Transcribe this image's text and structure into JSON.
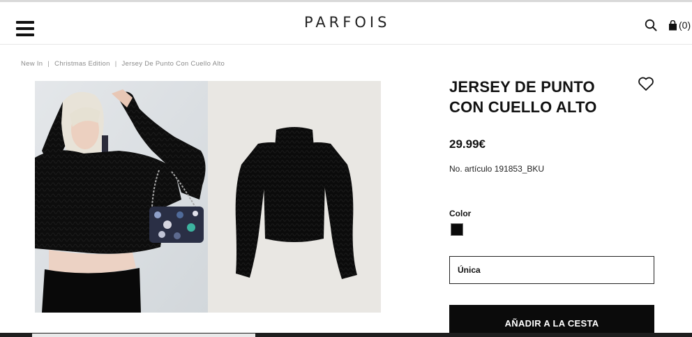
{
  "header": {
    "logo": "PARFOIS",
    "cart_count": "(0)"
  },
  "breadcrumb": [
    {
      "label": "New In"
    },
    {
      "label": "Christmas Edition"
    },
    {
      "label": "Jersey De Punto Con Cuello Alto"
    }
  ],
  "breadcrumb_separator": "|",
  "product": {
    "title": "JERSEY DE PUNTO CON CUELLO ALTO",
    "price": "29.99€",
    "sku": "No. artículo 191853_BKU",
    "color_label": "Color",
    "selected_color": "#0a0a0a",
    "size": "Única",
    "add_to_cart": "AÑADIR A LA CESTA"
  },
  "icons": {
    "menu": "hamburger-menu-icon",
    "search": "search-icon",
    "cart": "shopping-bag-icon",
    "wishlist": "heart-icon"
  },
  "colors": {
    "accent": "#0b0b0b",
    "text": "#111111",
    "muted": "#8a8a8a"
  }
}
